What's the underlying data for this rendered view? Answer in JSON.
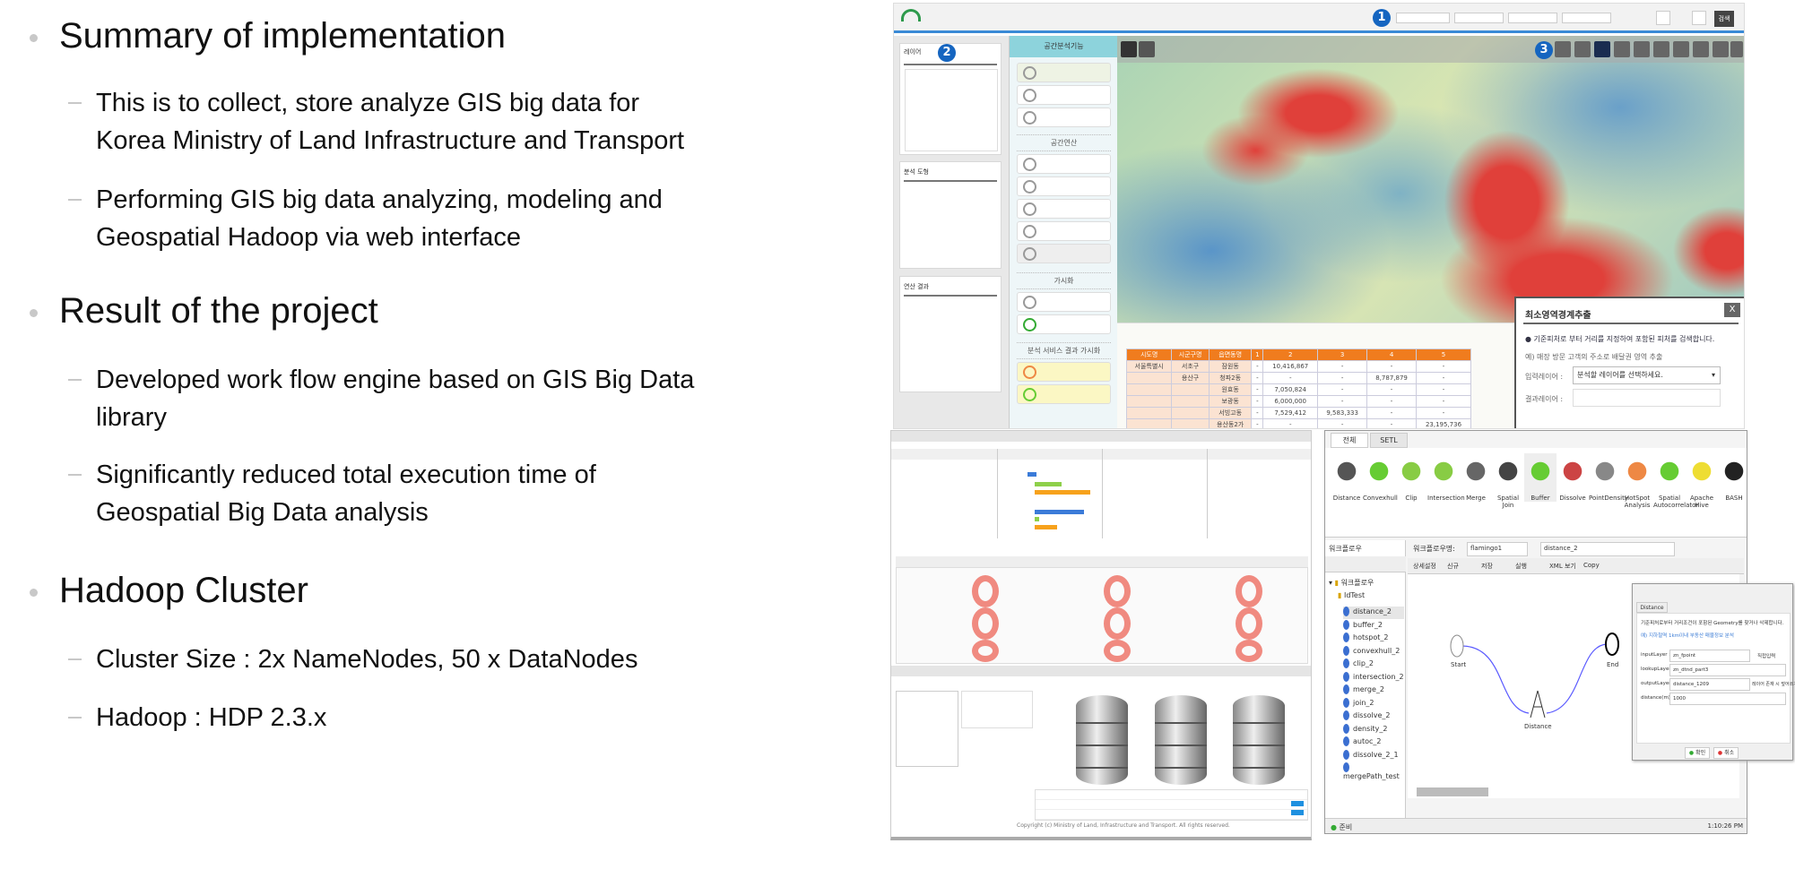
{
  "slide": {
    "sections": [
      {
        "heading": "Summary of implementation",
        "items": [
          [
            "This is to collect, store analyze GIS big data for",
            "Korea Ministry of Land Infrastructure and Transport"
          ],
          [
            "Performing GIS big data analyzing, modeling and",
            "Geospatial Hadoop via web interface"
          ]
        ]
      },
      {
        "heading": "Result of the project",
        "items": [
          [
            "Developed work flow engine based on GIS Big Data",
            "library"
          ],
          [
            "Significantly reduced total execution time of",
            "Geospatial Big Data analysis"
          ]
        ]
      },
      {
        "heading": "Hadoop Cluster",
        "items": [
          [
            "Cluster Size : 2x NameNodes, 50 x DataNodes"
          ],
          [
            "Hadoop : HDP 2.3.x"
          ]
        ]
      }
    ]
  },
  "gis_app": {
    "badges": [
      "1",
      "2",
      "3"
    ],
    "search_button": "검색",
    "nav_header": "공간분석기능",
    "nav_groups": [
      "공간연산",
      "가시화",
      "분석 서비스 결과 가시화"
    ],
    "left_panels": [
      "레이어",
      "분석 도형",
      "연산 결과"
    ],
    "table": {
      "headers": [
        "시도명",
        "시군구명",
        "읍면동명",
        "1",
        "2",
        "3",
        "4",
        "5"
      ],
      "rows": [
        [
          "서울특별시",
          "서초구",
          "잠원동",
          "-",
          "10,416,867",
          "-",
          "-",
          "-"
        ],
        [
          "",
          "용산구",
          "청파2동",
          "-",
          "-",
          "-",
          "8,787,879",
          "-"
        ],
        [
          "",
          "",
          "원효동",
          "-",
          "7,050,824",
          "-",
          "-",
          "-"
        ],
        [
          "",
          "",
          "보광동",
          "-",
          "6,000,000",
          "-",
          "-",
          "-"
        ],
        [
          "",
          "",
          "서빙고동",
          "-",
          "7,529,412",
          "9,583,333",
          "-",
          "-"
        ],
        [
          "",
          "",
          "용산동2가",
          "-",
          "-",
          "-",
          "-",
          "23,195,736"
        ]
      ]
    },
    "popup": {
      "title": "최소영역경계추출",
      "close": "X",
      "desc": "기준피처로 부터 거리를 지정하여 포함된 피처를 검색합니다.",
      "example": "예) 매장 방문 고객의 주소로 배달권 영역 추출",
      "input_label": "입력레이어 :",
      "input_value": "분석할 레이어를 선택하세요.",
      "output_label": "결과레이어 :"
    },
    "colors": {
      "heat_high": "#e0403a",
      "heat_low": "#4f8fc8",
      "table_header": "#f07c1e",
      "accent": "#1565c0"
    }
  },
  "dashboard": {
    "copyright": "Copyright (c) Ministry of Land, Infrastructure and Transport. All rights reserved."
  },
  "workflow": {
    "tabs": [
      "전체",
      "SETL"
    ],
    "palette": [
      "Distance",
      "Convexhull",
      "Clip",
      "Intersection",
      "Merge",
      "Spatial Join",
      "Buffer",
      "Dissolve",
      "PointDensity",
      "HotSpot Analysis",
      "Spatial Autocorrelator",
      "Apache Hive",
      "BASH"
    ],
    "tree_title": "워크플로우",
    "tree_root": "워크플로우",
    "tree_folder": "IdTest",
    "tree_items": [
      "distance_2",
      "buffer_2",
      "hotspot_2",
      "convexhull_2",
      "clip_2",
      "intersection_2",
      "merge_2",
      "join_2",
      "dissolve_2",
      "density_2",
      "autoc_2",
      "dissolve_2_1",
      "mergePath_test"
    ],
    "engine_label": "워크플로우명:",
    "engine_value": "flamingo1",
    "name_value": "distance_2",
    "toolbar": [
      "상세설정",
      "신규",
      "저장",
      "실행",
      "XML 보기",
      "Copy"
    ],
    "nodes": {
      "start": "Start",
      "end": "End",
      "op": "Distance"
    },
    "status": "준비",
    "time": "1:10:26 PM",
    "dialog": {
      "tab": "Distance",
      "desc": "기준피처로부터 거리조건이 포함된 Geometry를 찾거나 삭제합니다.",
      "example": "예) 지하철역 1km이내 부동산 매물정보 분석",
      "fields": [
        {
          "label": "inputLayer :",
          "value": "zn_fpoint"
        },
        {
          "label": "lookupLayer :",
          "value": "zn_dtnd_part3"
        },
        {
          "label": "outputLayer :",
          "value": "distance_1209"
        },
        {
          "label": "distance(m) :",
          "value": "1000"
        }
      ],
      "direct_input": "직접입력",
      "overwrite": "레이어 존재 시 덮어쓰기",
      "ok": "확인",
      "cancel": "취소"
    }
  }
}
